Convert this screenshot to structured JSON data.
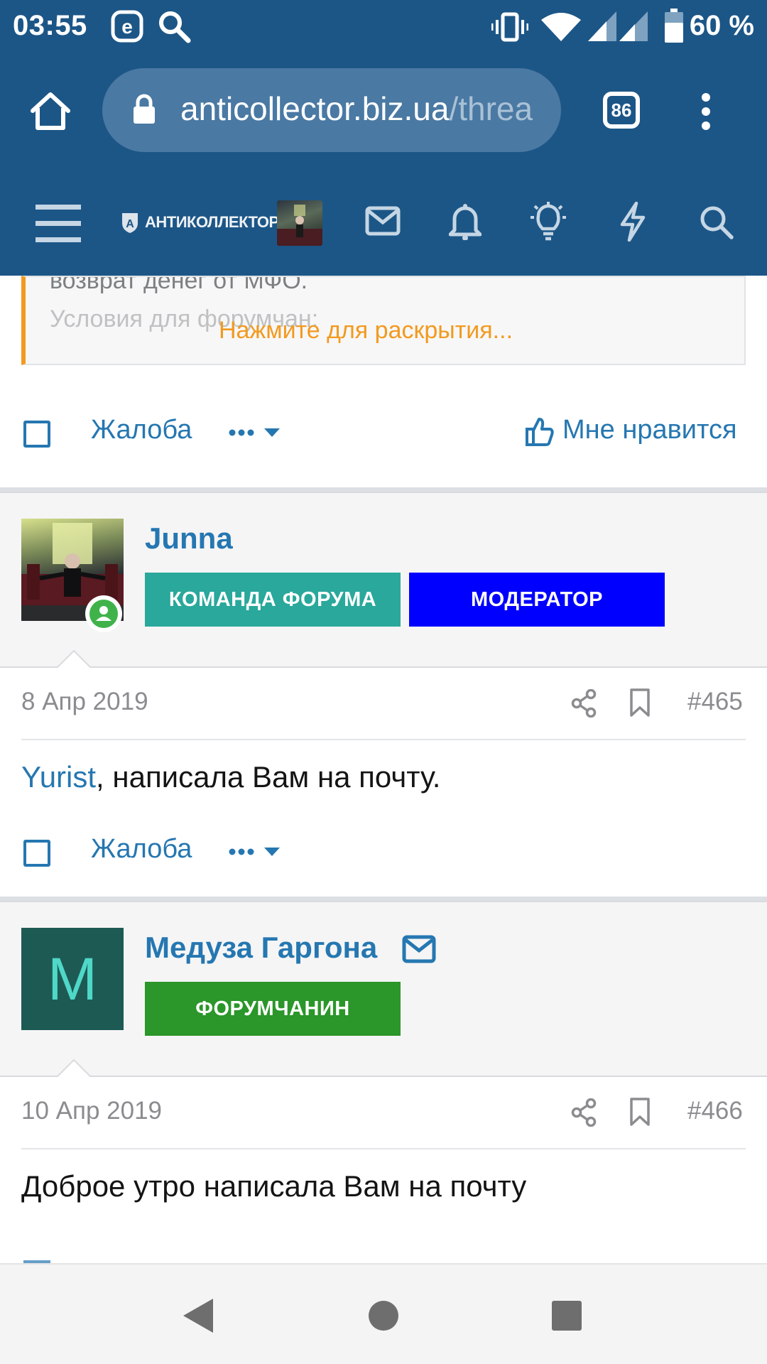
{
  "status_bar": {
    "time": "03:55",
    "battery": "60 %"
  },
  "browser": {
    "url_host": "anticollector.biz.ua",
    "url_path": "/threa",
    "tab_count": "86"
  },
  "forum_nav": {
    "logo_text": "АНТИКОЛЛЕКТОР"
  },
  "prev_post": {
    "quote_line1": "возврат денег от МФО.",
    "quote_line2": "Условия для форумчан:",
    "expand_label": "Нажмите для раскрытия...",
    "report_label": "Жалоба",
    "like_label": "Мне нравится"
  },
  "posts": [
    {
      "username": "Junna",
      "badges": [
        {
          "label": "КОМАНДА ФОРУМА",
          "color": "#29a89b"
        },
        {
          "label": "МОДЕРАТОР",
          "color": "#0000ff"
        }
      ],
      "date": "8 Апр 2019",
      "number": "#465",
      "mention": "Yurist",
      "message": ", написала Вам на почту.",
      "report_label": "Жалоба"
    },
    {
      "username": "Медуза Гаргона",
      "avatar_letter": "M",
      "badges": [
        {
          "label": "ФОРУМЧАНИН",
          "color": "#2b9629"
        }
      ],
      "date": "10 Апр 2019",
      "number": "#466",
      "message": "Доброе утро написала Вам на почту"
    }
  ],
  "colors": {
    "header": "#1c5687",
    "link": "#2577b1",
    "accent": "#f29a1f"
  }
}
